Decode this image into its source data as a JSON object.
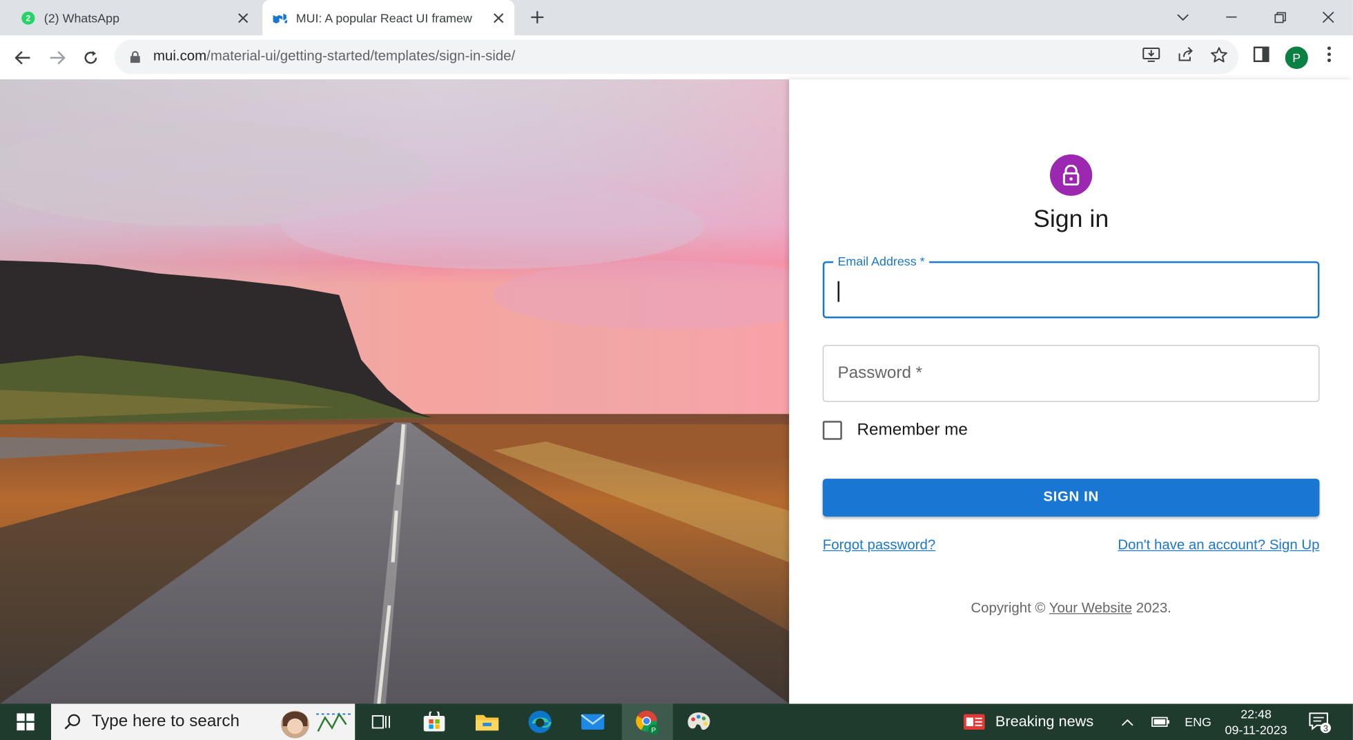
{
  "browser": {
    "tabs": [
      {
        "title": "(2) WhatsApp",
        "badge": "2",
        "active": false
      },
      {
        "title": "MUI: A popular React UI framew",
        "active": true
      }
    ],
    "url_host": "mui.com",
    "url_path": "/material-ui/getting-started/templates/sign-in-side/",
    "profile_initial": "P"
  },
  "page": {
    "title": "Sign in",
    "email_label": "Email Address *",
    "password_placeholder": "Password *",
    "remember_label": "Remember me",
    "signin_button": "SIGN IN",
    "forgot_link": "Forgot password?",
    "signup_link": "Don't have an account? Sign Up",
    "copyright_prefix": "Copyright © ",
    "copyright_site": "Your Website",
    "copyright_suffix": " 2023."
  },
  "taskbar": {
    "search_placeholder": "Type here to search",
    "news_label": "Breaking news",
    "language": "ENG",
    "time": "22:48",
    "date": "09-11-2023",
    "notification_count": "3"
  },
  "colors": {
    "primary": "#1976d2",
    "avatar": "#9c27b0",
    "profile": "#0b8043"
  }
}
